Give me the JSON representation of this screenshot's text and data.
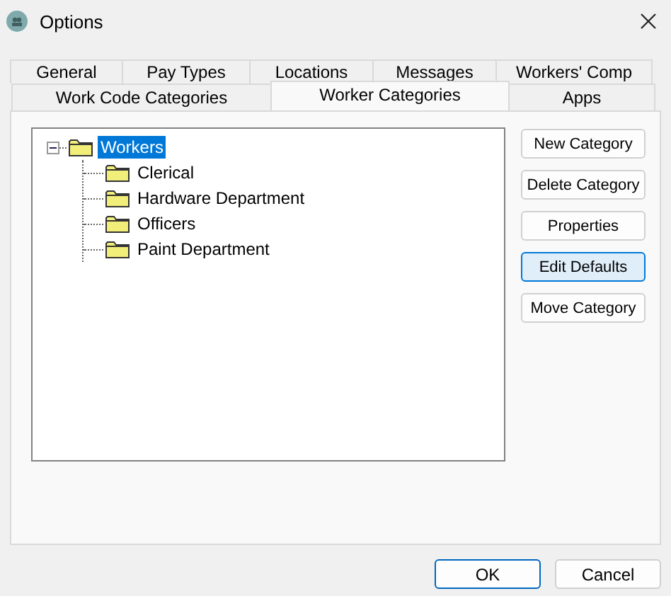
{
  "window": {
    "title": "Options"
  },
  "tab_rows": [
    [
      {
        "label": "General",
        "selected": false
      },
      {
        "label": "Pay Types",
        "selected": false
      },
      {
        "label": "Locations",
        "selected": false
      },
      {
        "label": "Messages",
        "selected": false
      },
      {
        "label": "Workers' Comp",
        "selected": false
      }
    ],
    [
      {
        "label": "Work Code Categories",
        "selected": false
      },
      {
        "label": "Worker Categories",
        "selected": true
      },
      {
        "label": "Apps",
        "selected": false
      }
    ]
  ],
  "tree": [
    {
      "label": "Workers",
      "selected": true,
      "expanded": true,
      "children": [
        {
          "label": "Clerical",
          "selected": false
        },
        {
          "label": "Hardware Department",
          "selected": false
        },
        {
          "label": "Officers",
          "selected": false
        },
        {
          "label": "Paint Department",
          "selected": false
        }
      ]
    }
  ],
  "side_buttons": [
    {
      "label": "New Category",
      "highlighted": false
    },
    {
      "label": "Delete Category",
      "highlighted": false
    },
    {
      "label": "Properties",
      "highlighted": false
    },
    {
      "label": "Edit Defaults",
      "highlighted": true
    },
    {
      "label": "Move Category",
      "highlighted": false
    }
  ],
  "dialog_buttons": [
    {
      "label": "OK",
      "default": true
    },
    {
      "label": "Cancel",
      "default": false
    }
  ]
}
